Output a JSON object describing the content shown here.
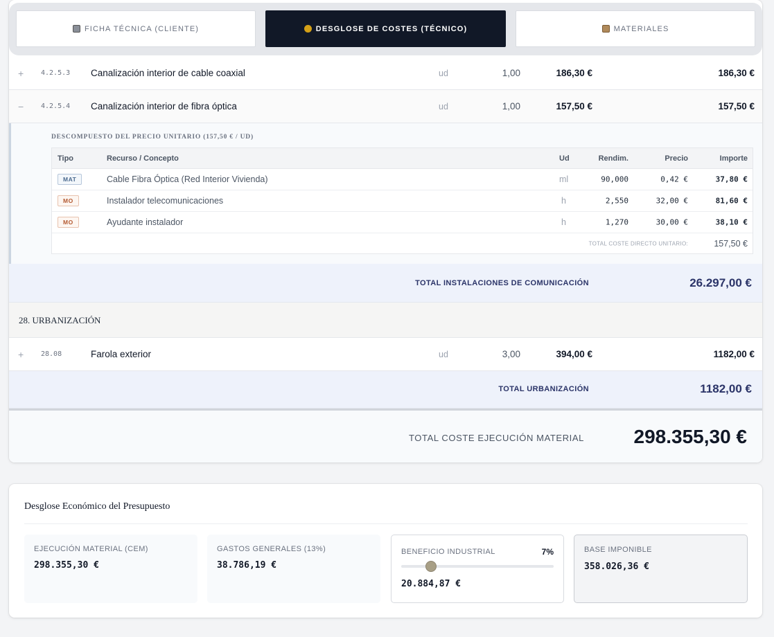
{
  "tabs": [
    {
      "label": "FICHA TÉCNICA (CLIENTE)",
      "icon": "document-icon"
    },
    {
      "label": "DESGLOSE DE COSTES (TÉCNICO)",
      "icon": "money-bag-icon",
      "active": true
    },
    {
      "label": "MATERIALES",
      "icon": "box-icon"
    }
  ],
  "rows": [
    {
      "toggle": "+",
      "code": "4.2.5.3",
      "desc": "Canalización interior de cable coaxial",
      "unit": "ud",
      "qty": "1,00",
      "price": "186,30 €",
      "amount": "186,30 €"
    },
    {
      "toggle": "−",
      "code": "4.2.5.4",
      "desc": "Canalización interior de fibra óptica",
      "unit": "ud",
      "qty": "1,00",
      "price": "157,50 €",
      "amount": "157,50 €"
    },
    {
      "toggle": "+",
      "code": "28.08",
      "desc": "Farola exterior",
      "unit": "ud",
      "qty": "3,00",
      "price": "394,00 €",
      "amount": "1182,00 €"
    }
  ],
  "decomp": {
    "title": "DESCOMPUESTO DEL PRECIO UNITARIO (157,50 € / UD)",
    "headers": {
      "tipo": "Tipo",
      "recurso": "Recurso / Concepto",
      "ud": "Ud",
      "rend": "Rendim.",
      "precio": "Precio",
      "importe": "Importe"
    },
    "items": [
      {
        "tipo": "MAT",
        "recurso": "Cable Fibra Óptica (Red Interior Vivienda)",
        "ud": "ml",
        "rend": "90,000",
        "precio": "0,42 €",
        "importe": "37,80 €"
      },
      {
        "tipo": "MO",
        "recurso": "Instalador telecomunicaciones",
        "ud": "h",
        "rend": "2,550",
        "precio": "32,00 €",
        "importe": "81,60 €"
      },
      {
        "tipo": "MO",
        "recurso": "Ayudante instalador",
        "ud": "h",
        "rend": "1,270",
        "precio": "30,00 €",
        "importe": "38,10 €"
      }
    ],
    "total_label": "TOTAL COSTE DIRECTO UNITARIO:",
    "total_value": "157,50 €"
  },
  "subtotals": {
    "comunicacion": {
      "label": "TOTAL INSTALACIONES DE COMUNICACIÓN",
      "value": "26.297,00 €"
    },
    "urbanizacion": {
      "label": "TOTAL URBANIZACIÓN",
      "value": "1182,00 €"
    }
  },
  "chapter": {
    "title": "28. URBANIZACIÓN"
  },
  "grand": {
    "label": "TOTAL COSTE EJECUCIÓN MATERIAL",
    "value": "298.355,30 €"
  },
  "econ": {
    "title": "Desglose Económico del Presupuesto",
    "cem": {
      "label": "EJECUCIÓN MATERIAL (CEM)",
      "value": "298.355,30 €"
    },
    "gg": {
      "label": "GASTOS GENERALES (13%)",
      "value": "38.786,19 €"
    },
    "bi": {
      "label": "BENEFICIO INDUSTRIAL",
      "percent": "7%",
      "value": "20.884,87 €",
      "slider_fraction": 0.17
    },
    "base": {
      "label": "BASE IMPONIBLE",
      "value": "358.026,36 €"
    }
  }
}
